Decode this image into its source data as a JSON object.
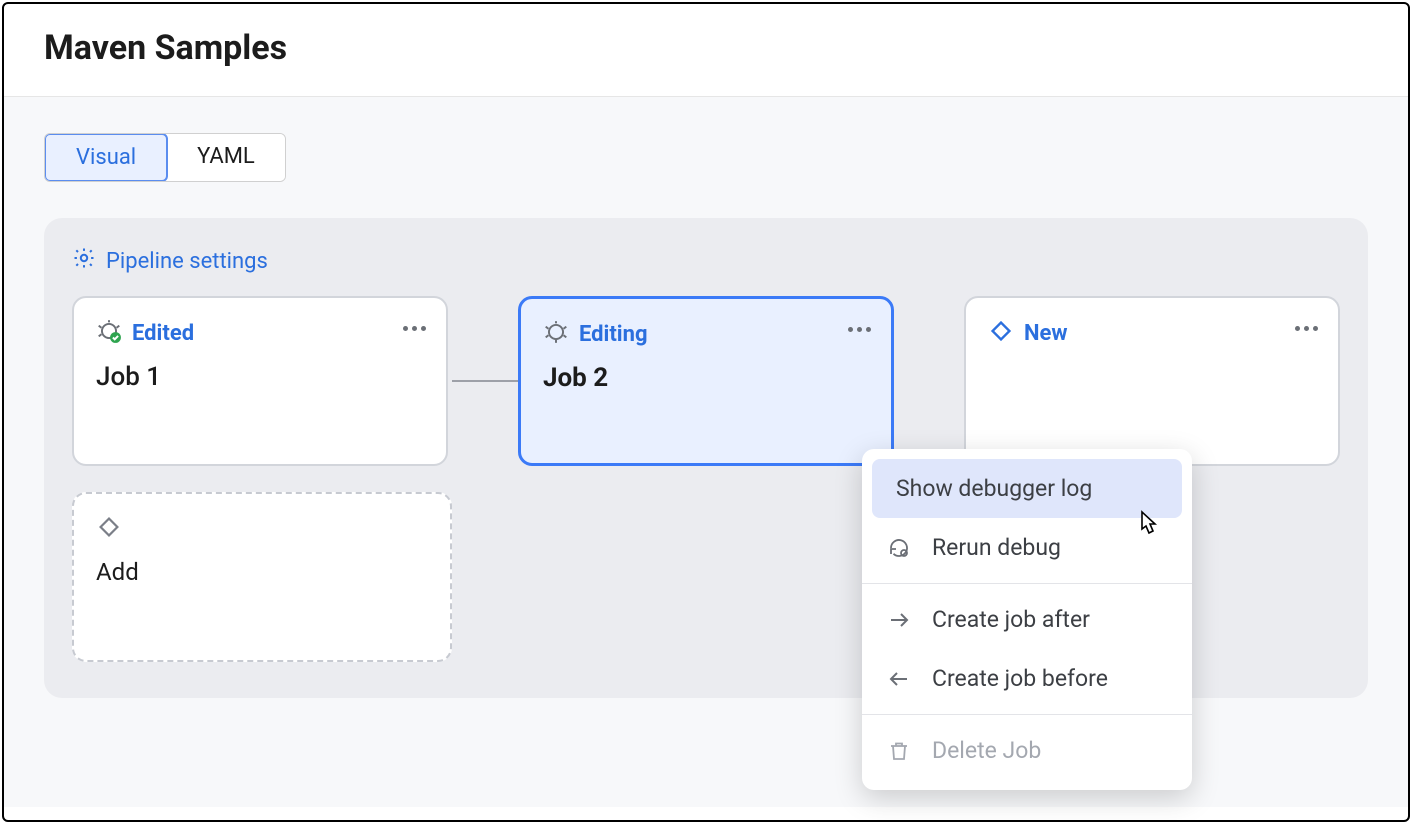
{
  "page": {
    "title": "Maven Samples"
  },
  "tabs": {
    "visual": "Visual",
    "yaml": "YAML",
    "active": "visual"
  },
  "settings_link": "Pipeline settings",
  "jobs": [
    {
      "status": "Edited",
      "name": "Job 1",
      "selected": false,
      "icon": "bug-check"
    },
    {
      "status": "Editing",
      "name": "Job 2",
      "selected": true,
      "icon": "bug"
    },
    {
      "status": "New",
      "name": "",
      "selected": false,
      "icon": "diamond"
    }
  ],
  "add_card": {
    "label": "Add"
  },
  "context_menu": {
    "items": [
      {
        "label": "Show debugger log",
        "icon": null,
        "highlight": true,
        "disabled": false
      },
      {
        "label": "Rerun debug",
        "icon": "rerun-debug",
        "highlight": false,
        "disabled": false
      },
      {
        "divider": true
      },
      {
        "label": "Create job after",
        "icon": "arrow-right",
        "highlight": false,
        "disabled": false
      },
      {
        "label": "Create job before",
        "icon": "arrow-left",
        "highlight": false,
        "disabled": false
      },
      {
        "divider": true
      },
      {
        "label": "Delete Job",
        "icon": "trash",
        "highlight": false,
        "disabled": true
      }
    ]
  }
}
